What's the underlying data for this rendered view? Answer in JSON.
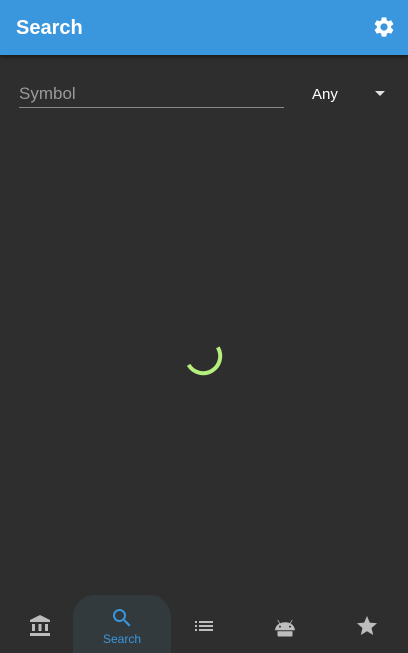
{
  "appbar": {
    "title": "Search",
    "settings_icon": "gear-icon"
  },
  "search": {
    "symbol_placeholder": "Symbol",
    "symbol_value": "",
    "type_selected": "Any"
  },
  "status": {
    "loading_indicator": "spinner"
  },
  "nav": {
    "items": [
      {
        "icon": "bank-icon",
        "label": "",
        "active": false
      },
      {
        "icon": "search-icon",
        "label": "Search",
        "active": true
      },
      {
        "icon": "list-icon",
        "label": "",
        "active": false
      },
      {
        "icon": "android-icon",
        "label": "",
        "active": false
      },
      {
        "icon": "star-icon",
        "label": "",
        "active": false
      }
    ]
  },
  "colors": {
    "primary": "#3a96dd",
    "background": "#2e2e2e",
    "spinner": "#b5f07d",
    "nav_inactive_icon": "#bdbdbd"
  }
}
